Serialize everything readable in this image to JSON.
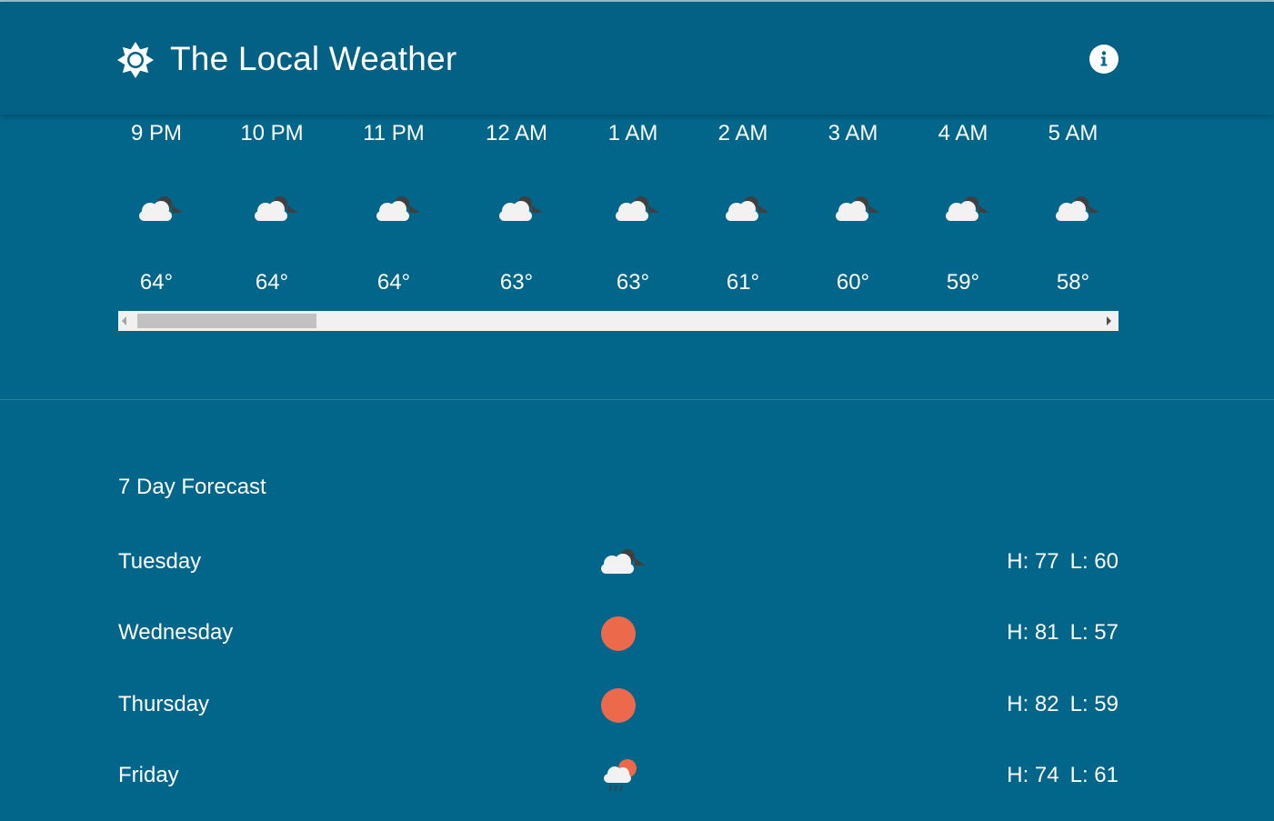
{
  "app": {
    "title": "The Local Weather",
    "logo_icon": "sun-gear-icon",
    "info_icon": "info-icon"
  },
  "colors": {
    "background": "#02658a",
    "header": "#026185",
    "sun": "#ec6a4b",
    "cloud": "#f2f2f2",
    "cloud_dark": "#4a4a4a"
  },
  "hourly": [
    {
      "time": "9 PM",
      "temp": "64°",
      "icon": "partly-cloudy-night-icon"
    },
    {
      "time": "10 PM",
      "temp": "64°",
      "icon": "partly-cloudy-night-icon"
    },
    {
      "time": "11 PM",
      "temp": "64°",
      "icon": "partly-cloudy-night-icon"
    },
    {
      "time": "12 AM",
      "temp": "63°",
      "icon": "partly-cloudy-night-icon"
    },
    {
      "time": "1 AM",
      "temp": "63°",
      "icon": "partly-cloudy-night-icon"
    },
    {
      "time": "2 AM",
      "temp": "61°",
      "icon": "partly-cloudy-night-icon"
    },
    {
      "time": "3 AM",
      "temp": "60°",
      "icon": "partly-cloudy-night-icon"
    },
    {
      "time": "4 AM",
      "temp": "59°",
      "icon": "partly-cloudy-night-icon"
    },
    {
      "time": "5 AM",
      "temp": "58°",
      "icon": "partly-cloudy-night-icon"
    }
  ],
  "forecast": {
    "title": "7 Day Forecast",
    "days": [
      {
        "day": "Tuesday",
        "high": "H: 77",
        "low": "L: 60",
        "icon": "partly-cloudy-night-icon"
      },
      {
        "day": "Wednesday",
        "high": "H: 81",
        "low": "L: 57",
        "icon": "clear-day-icon"
      },
      {
        "day": "Thursday",
        "high": "H: 82",
        "low": "L: 59",
        "icon": "clear-day-icon"
      },
      {
        "day": "Friday",
        "high": "H: 74",
        "low": "L: 61",
        "icon": "rain-sun-icon"
      }
    ]
  }
}
